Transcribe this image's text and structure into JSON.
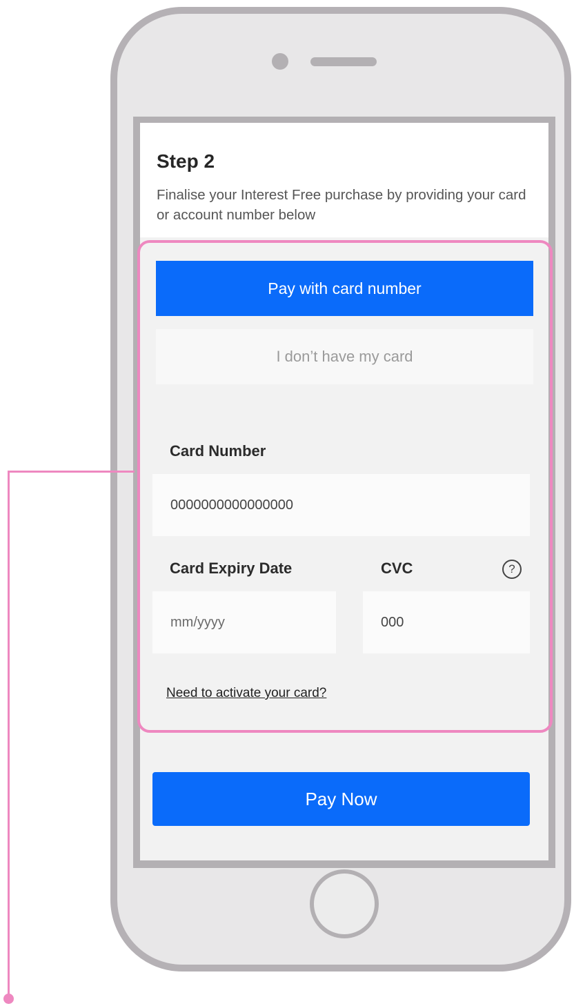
{
  "header": {
    "title": "Step 2",
    "description": "Finalise your Interest Free purchase by providing your card or account number below"
  },
  "payment_options": {
    "card_number_tab": "Pay with card number",
    "no_card_tab": "I don’t have my card"
  },
  "form": {
    "card_number_label": "Card Number",
    "card_number_value": "0000000000000000",
    "expiry_label": "Card Expiry Date",
    "expiry_value": "mm/yyyy",
    "cvc_label": "CVC",
    "cvc_value": "000",
    "help_glyph": "?",
    "activate_link": "Need to activate your card?"
  },
  "actions": {
    "pay_now": "Pay Now"
  },
  "colors": {
    "primary": "#0a6bfa",
    "highlight": "#ee88c0",
    "phone_frame": "#b5b1b5"
  },
  "icons": [
    "question-mark-icon"
  ]
}
